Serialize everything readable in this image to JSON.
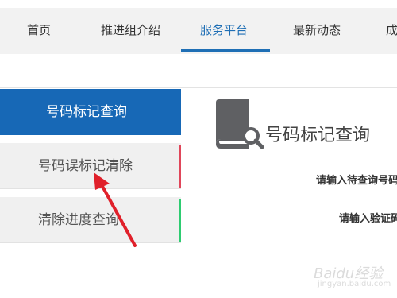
{
  "nav": {
    "items": [
      {
        "label": "首页"
      },
      {
        "label": "推进组介绍"
      },
      {
        "label": "服务平台"
      },
      {
        "label": "最新动态"
      },
      {
        "label": "成"
      }
    ],
    "active_index": 2
  },
  "sidebar": {
    "items": [
      {
        "label": "号码标记查询",
        "active": true
      },
      {
        "label": "号码误标记清除",
        "accent": "#e0465a"
      },
      {
        "label": "清除进度查询",
        "accent": "#2ecc71"
      }
    ]
  },
  "main": {
    "title": "号码标记查询",
    "fields": [
      {
        "label": "请输入待查询号码"
      },
      {
        "label": "请输入验证码"
      }
    ]
  },
  "watermark": {
    "text": "Baidu经验",
    "sub": "jingyan.baidu.com"
  },
  "colors": {
    "accent": "#1768b6",
    "arrow": "#e0202a"
  }
}
